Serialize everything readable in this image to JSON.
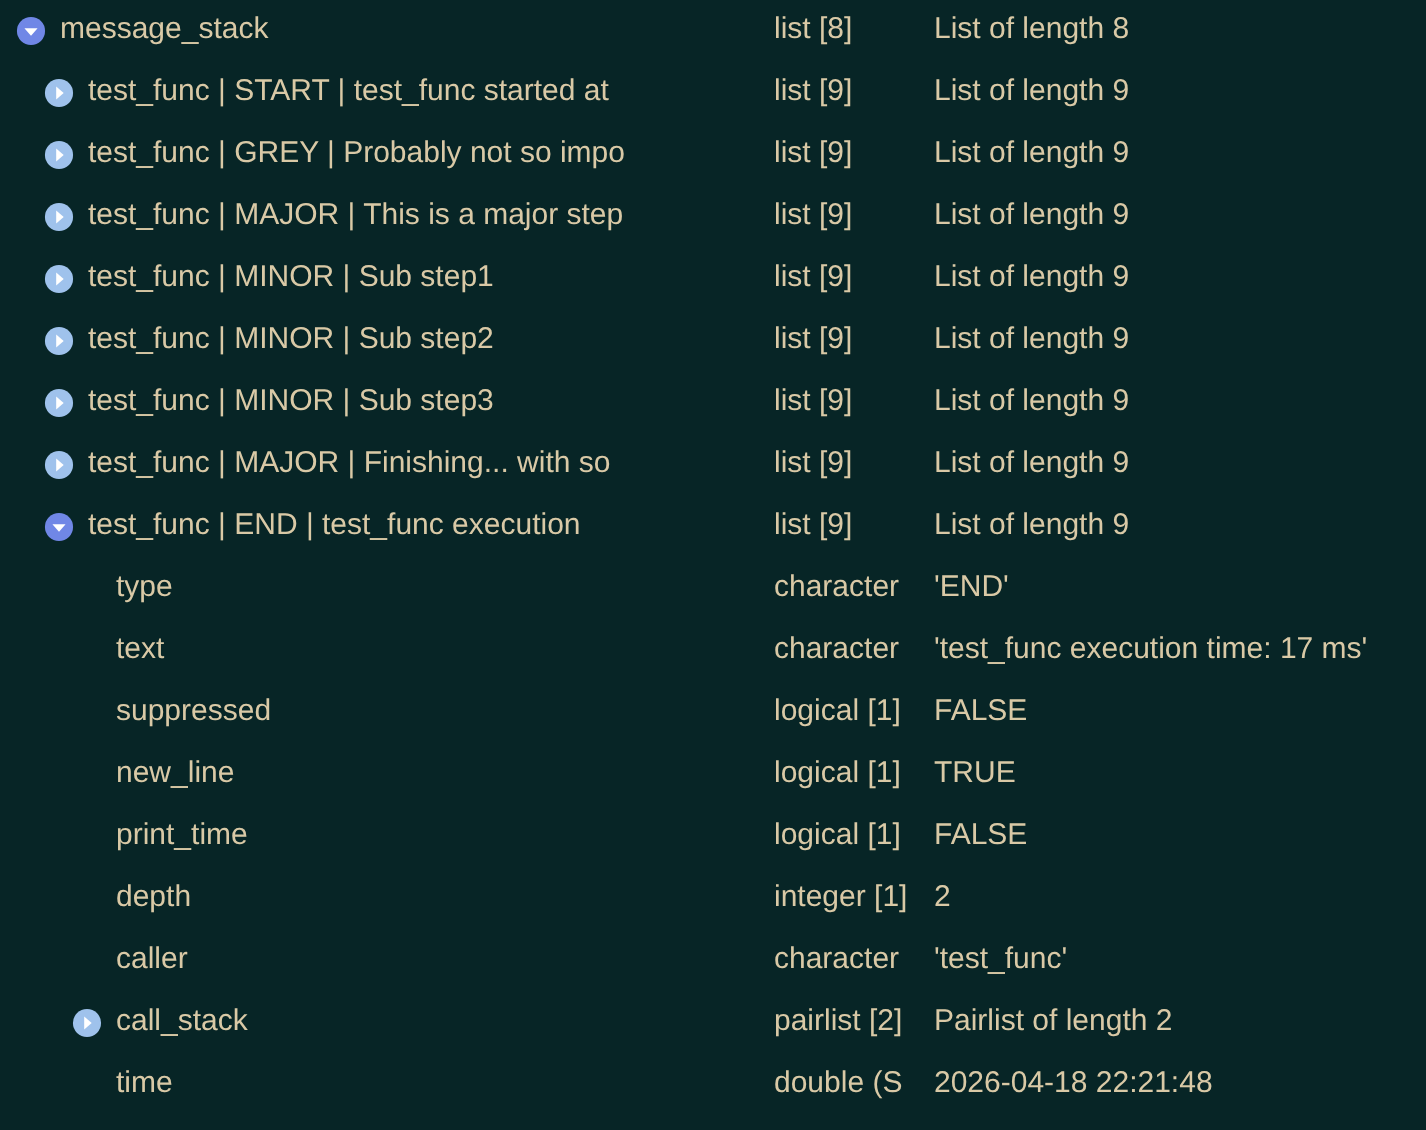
{
  "tree": [
    {
      "kind": "group",
      "name": "message_stack",
      "type": "list [8]",
      "value": "List of length 8",
      "expanded": true,
      "children": [
        {
          "kind": "group",
          "name": "test_func | START | test_func started at",
          "type": "list [9]",
          "value": "List of length 9",
          "expanded": false
        },
        {
          "kind": "group",
          "name": "test_func | GREY | Probably not so impo",
          "type": "list [9]",
          "value": "List of length 9",
          "expanded": false
        },
        {
          "kind": "group",
          "name": "test_func | MAJOR | This is a major step",
          "type": "list [9]",
          "value": "List of length 9",
          "expanded": false
        },
        {
          "kind": "group",
          "name": "test_func | MINOR | Sub step1",
          "type": "list [9]",
          "value": "List of length 9",
          "expanded": false
        },
        {
          "kind": "group",
          "name": "test_func | MINOR | Sub step2",
          "type": "list [9]",
          "value": "List of length 9",
          "expanded": false
        },
        {
          "kind": "group",
          "name": "test_func | MINOR | Sub step3",
          "type": "list [9]",
          "value": "List of length 9",
          "expanded": false
        },
        {
          "kind": "group",
          "name": "test_func | MAJOR | Finishing... with so",
          "type": "list [9]",
          "value": "List of length 9",
          "expanded": false
        },
        {
          "kind": "group",
          "name": "test_func | END | test_func execution",
          "type": "list [9]",
          "value": "List of length 9",
          "expanded": true,
          "children": [
            {
              "kind": "leaf",
              "name": "type",
              "type": "character",
              "value": "'END'"
            },
            {
              "kind": "leaf",
              "name": "text",
              "type": "character",
              "value": "'test_func execution time: 17 ms'"
            },
            {
              "kind": "leaf",
              "name": "suppressed",
              "type": "logical [1]",
              "value": "FALSE"
            },
            {
              "kind": "leaf",
              "name": "new_line",
              "type": "logical [1]",
              "value": "TRUE"
            },
            {
              "kind": "leaf",
              "name": "print_time",
              "type": "logical [1]",
              "value": "FALSE"
            },
            {
              "kind": "leaf",
              "name": "depth",
              "type": "integer [1]",
              "value": "2"
            },
            {
              "kind": "leaf",
              "name": "caller",
              "type": "character",
              "value": "'test_func'"
            },
            {
              "kind": "group",
              "name": "call_stack",
              "type": "pairlist [2]",
              "value": "Pairlist of length 2",
              "expanded": false
            },
            {
              "kind": "leaf",
              "name": "time",
              "type": "double (S",
              "value": "2026-04-18 22:21:48"
            }
          ]
        }
      ]
    }
  ]
}
